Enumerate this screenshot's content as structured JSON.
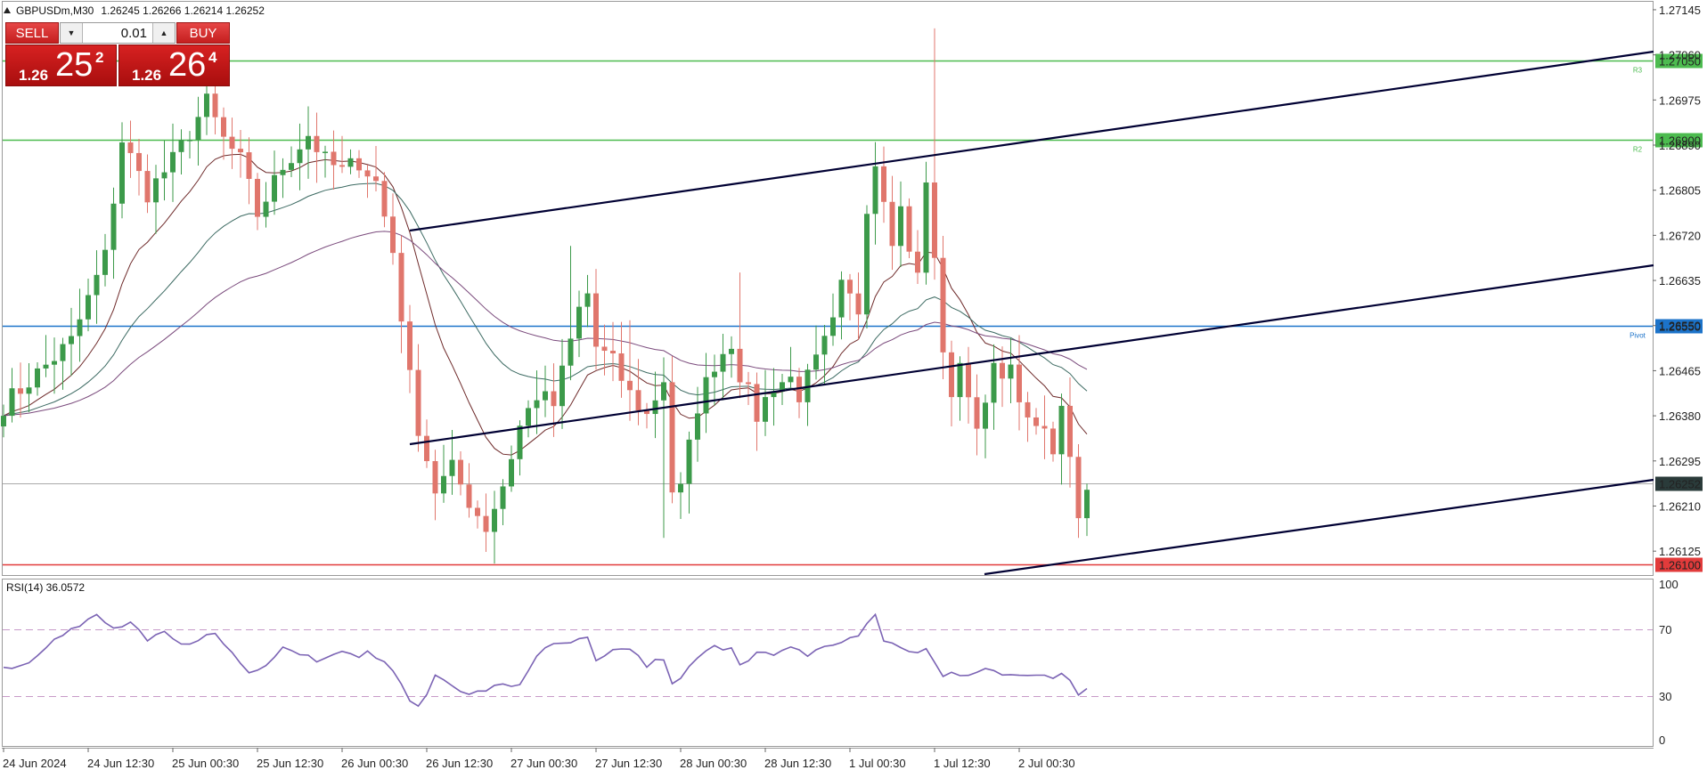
{
  "header": {
    "symbol_text": "GBPUSDm,M30",
    "ohlc_text": "1.26245 1.26266 1.26214 1.26252"
  },
  "trade_panel": {
    "sell_label": "SELL",
    "buy_label": "BUY",
    "lot_value": "0.01",
    "sell_price_prefix": "1.26",
    "sell_price_big": "25",
    "sell_price_sup": "2",
    "buy_price_prefix": "1.26",
    "buy_price_big": "26",
    "buy_price_sup": "4"
  },
  "colors": {
    "bull": "#3c9a4a",
    "bear": "#e0766c",
    "pivot": "#1c73c9",
    "resistance": "#4cbb4f",
    "support": "#e23b3b",
    "trendline": "#000033",
    "rsi": "#7b63b4",
    "rsi_level": "#c79ac8",
    "ma_fast": "#6e2a2a",
    "ma_mid": "#3c6a62",
    "ma_slow": "#7a4a7c"
  },
  "chart_data": [
    {
      "type": "candlestick",
      "symbol": "GBPUSDm",
      "timeframe": "M30",
      "last_price": "1.26252",
      "ylim": [
        1.2608,
        1.2716
      ],
      "y_ticks": [
        "1.27145",
        "1.27060",
        "1.26975",
        "1.26890",
        "1.26805",
        "1.26720",
        "1.26635",
        "1.26550",
        "1.26465",
        "1.26380",
        "1.26295",
        "1.26210",
        "1.26125"
      ],
      "x_ticks": [
        "24 Jun 2024",
        "24 Jun 12:30",
        "25 Jun 00:30",
        "25 Jun 12:30",
        "26 Jun 00:30",
        "26 Jun 12:30",
        "27 Jun 00:30",
        "27 Jun 12:30",
        "28 Jun 00:30",
        "28 Jun 12:30",
        "1 Jul 00:30",
        "1 Jul 12:30",
        "2 Jul 00:30"
      ],
      "levels": [
        {
          "label": "R3",
          "value": 1.2705,
          "price_text": "1.27050",
          "kind": "resistance"
        },
        {
          "label": "R2",
          "value": 1.269,
          "price_text": "1.26900",
          "kind": "resistance"
        },
        {
          "label": "Pivot",
          "value": 1.2655,
          "price_text": "1.26550",
          "kind": "pivot"
        },
        {
          "label": "",
          "value": 1.261,
          "price_text": "1.26100",
          "kind": "support"
        },
        {
          "label": "",
          "value": 1.26252,
          "price_text": "1.26252",
          "kind": "current"
        }
      ],
      "anchors": [
        [
          0,
          1.264
        ],
        [
          8,
          1.2652
        ],
        [
          12,
          1.2668
        ],
        [
          14,
          1.269
        ],
        [
          17,
          1.268
        ],
        [
          20,
          1.2686
        ],
        [
          24,
          1.2697
        ],
        [
          26,
          1.269
        ],
        [
          28,
          1.2686
        ],
        [
          30,
          1.2676
        ],
        [
          33,
          1.2685
        ],
        [
          36,
          1.2691
        ],
        [
          38,
          1.2686
        ],
        [
          40,
          1.2684
        ],
        [
          42,
          1.2686
        ],
        [
          44,
          1.2682
        ],
        [
          46,
          1.2669
        ],
        [
          48,
          1.2645
        ],
        [
          49,
          1.2636
        ],
        [
          51,
          1.2624
        ],
        [
          53,
          1.2628
        ],
        [
          55,
          1.2622
        ],
        [
          57,
          1.2617
        ],
        [
          59,
          1.2625
        ],
        [
          61,
          1.2636
        ],
        [
          63,
          1.2642
        ],
        [
          65,
          1.264
        ],
        [
          67,
          1.2652
        ],
        [
          68,
          1.2658
        ],
        [
          69,
          1.2661
        ],
        [
          70,
          1.2651
        ],
        [
          72,
          1.2648
        ],
        [
          74,
          1.2642
        ],
        [
          76,
          1.2638
        ],
        [
          78,
          1.2645
        ],
        [
          79,
          1.2624
        ],
        [
          80,
          1.2624
        ],
        [
          82,
          1.264
        ],
        [
          84,
          1.2648
        ],
        [
          86,
          1.2652
        ],
        [
          87,
          1.2646
        ],
        [
          88,
          1.2642
        ],
        [
          89,
          1.2638
        ],
        [
          91,
          1.2644
        ],
        [
          93,
          1.2645
        ],
        [
          94,
          1.2642
        ],
        [
          96,
          1.2648
        ],
        [
          98,
          1.2655
        ],
        [
          99,
          1.2662
        ],
        [
          101,
          1.2658
        ],
        [
          102,
          1.2678
        ],
        [
          103,
          1.2686
        ],
        [
          104,
          1.268
        ],
        [
          105,
          1.2672
        ],
        [
          106,
          1.2677
        ],
        [
          107,
          1.267
        ],
        [
          108,
          1.2664
        ],
        [
          109,
          1.2682
        ],
        [
          110,
          1.2667
        ],
        [
          111,
          1.2651
        ],
        [
          112,
          1.264
        ],
        [
          113,
          1.2649
        ],
        [
          114,
          1.2642
        ],
        [
          115,
          1.2634
        ],
        [
          116,
          1.2642
        ],
        [
          117,
          1.2648
        ],
        [
          119,
          1.2646
        ],
        [
          120,
          1.264
        ],
        [
          121,
          1.2636
        ],
        [
          122,
          1.2638
        ],
        [
          123,
          1.2634
        ],
        [
          124,
          1.2632
        ],
        [
          125,
          1.2638
        ],
        [
          126,
          1.263
        ],
        [
          127,
          1.2618
        ],
        [
          128,
          1.2625
        ]
      ]
    },
    {
      "type": "line",
      "title": "RSI(14) 36.0572",
      "ylim": [
        0,
        100
      ],
      "y_ticks": [
        "100",
        "70",
        "30",
        "0"
      ],
      "levels": [
        70,
        30
      ],
      "anchors": [
        [
          0,
          47
        ],
        [
          3,
          50
        ],
        [
          6,
          66
        ],
        [
          9,
          72
        ],
        [
          11,
          78
        ],
        [
          13,
          70
        ],
        [
          15,
          74
        ],
        [
          17,
          62
        ],
        [
          19,
          68
        ],
        [
          21,
          60
        ],
        [
          23,
          65
        ],
        [
          25,
          67
        ],
        [
          27,
          56
        ],
        [
          29,
          44
        ],
        [
          31,
          50
        ],
        [
          33,
          60
        ],
        [
          35,
          56
        ],
        [
          37,
          52
        ],
        [
          39,
          57
        ],
        [
          41,
          54
        ],
        [
          43,
          56
        ],
        [
          45,
          51
        ],
        [
          47,
          36
        ],
        [
          49,
          22
        ],
        [
          51,
          42
        ],
        [
          53,
          38
        ],
        [
          55,
          30
        ],
        [
          57,
          34
        ],
        [
          59,
          36
        ],
        [
          61,
          37
        ],
        [
          63,
          55
        ],
        [
          65,
          60
        ],
        [
          67,
          62
        ],
        [
          69,
          64
        ],
        [
          70,
          50
        ],
        [
          72,
          56
        ],
        [
          74,
          59
        ],
        [
          76,
          48
        ],
        [
          78,
          53
        ],
        [
          79,
          36
        ],
        [
          80,
          40
        ],
        [
          82,
          53
        ],
        [
          84,
          59
        ],
        [
          86,
          60
        ],
        [
          87,
          50
        ],
        [
          89,
          56
        ],
        [
          91,
          54
        ],
        [
          93,
          58
        ],
        [
          95,
          55
        ],
        [
          97,
          60
        ],
        [
          99,
          62
        ],
        [
          101,
          66
        ],
        [
          102,
          74
        ],
        [
          103,
          79
        ],
        [
          104,
          64
        ],
        [
          106,
          58
        ],
        [
          108,
          57
        ],
        [
          109,
          58
        ],
        [
          110,
          50
        ],
        [
          111,
          40
        ],
        [
          112,
          44
        ],
        [
          114,
          42
        ],
        [
          116,
          46
        ],
        [
          118,
          44
        ],
        [
          120,
          44
        ],
        [
          122,
          42
        ],
        [
          124,
          40
        ],
        [
          125,
          44
        ],
        [
          126,
          40
        ],
        [
          127,
          31
        ],
        [
          128,
          36
        ]
      ]
    }
  ]
}
